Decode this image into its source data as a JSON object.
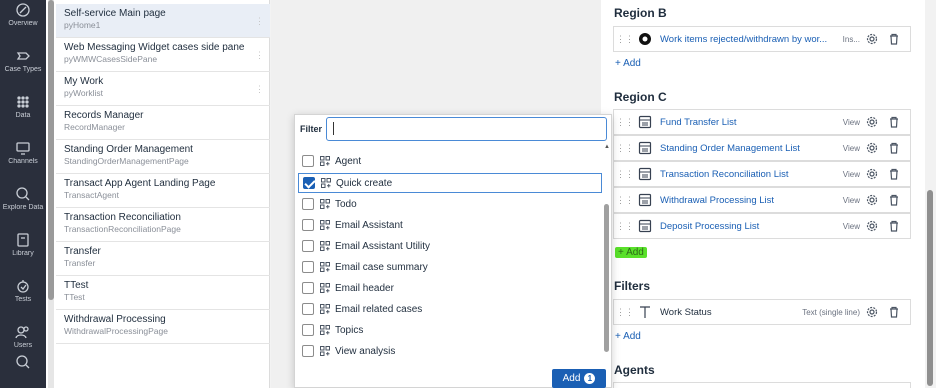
{
  "nav": [
    {
      "label": "Overview",
      "icon": "compass-icon"
    },
    {
      "label": "Case Types",
      "icon": "case-types-icon"
    },
    {
      "label": "Data",
      "icon": "grid-icon"
    },
    {
      "label": "Channels",
      "icon": "channels-icon"
    },
    {
      "label": "Explore Data",
      "icon": "explore-icon"
    },
    {
      "label": "Library",
      "icon": "library-icon"
    },
    {
      "label": "Tests",
      "icon": "tests-icon"
    },
    {
      "label": "Users",
      "icon": "users-icon"
    }
  ],
  "pages": [
    {
      "title": "Self-service Main page",
      "sub": "pyHome1"
    },
    {
      "title": "Web Messaging Widget cases side pane",
      "sub": "pyWMWCasesSidePane"
    },
    {
      "title": "My Work",
      "sub": "pyWorklist"
    },
    {
      "title": "Records Manager",
      "sub": "RecordManager"
    },
    {
      "title": "Standing Order Management",
      "sub": "StandingOrderManagementPage"
    },
    {
      "title": "Transact App Agent Landing Page",
      "sub": "TransactAgent"
    },
    {
      "title": "Transaction Reconciliation",
      "sub": "TransactionReconciliationPage"
    },
    {
      "title": "Transfer",
      "sub": "Transfer"
    },
    {
      "title": "TTest",
      "sub": "TTest"
    },
    {
      "title": "Withdrawal Processing",
      "sub": "WithdrawalProcessingPage"
    }
  ],
  "popup": {
    "filter_label": "Filter",
    "filter_value": "",
    "options": [
      {
        "label": "Agent",
        "checked": false
      },
      {
        "label": "Quick create",
        "checked": true
      },
      {
        "label": "Todo",
        "checked": false
      },
      {
        "label": "Email Assistant",
        "checked": false
      },
      {
        "label": "Email Assistant Utility",
        "checked": false
      },
      {
        "label": "Email case summary",
        "checked": false
      },
      {
        "label": "Email header",
        "checked": false
      },
      {
        "label": "Email related cases",
        "checked": false
      },
      {
        "label": "Topics",
        "checked": false
      },
      {
        "label": "View analysis",
        "checked": false
      }
    ],
    "add_label": "Add",
    "add_count": "1"
  },
  "right": {
    "region_b": {
      "title": "Region B",
      "rows": [
        {
          "label": "Work items rejected/withdrawn by wor...",
          "type": "Ins..."
        }
      ],
      "add": "+ Add"
    },
    "region_c": {
      "title": "Region C",
      "rows": [
        {
          "label": "Fund Transfer List",
          "type": "View"
        },
        {
          "label": "Standing Order Management List",
          "type": "View"
        },
        {
          "label": "Transaction Reconciliation List",
          "type": "View"
        },
        {
          "label": "Withdrawal Processing List",
          "type": "View"
        },
        {
          "label": "Deposit Processing List",
          "type": "View"
        }
      ],
      "add": "+ Add"
    },
    "filters": {
      "title": "Filters",
      "rows": [
        {
          "label": "Work Status",
          "type": "Text (single line)"
        }
      ],
      "add": "+ Add"
    },
    "agents": {
      "title": "Agents"
    }
  },
  "colors": {
    "accent": "#1a5fb4",
    "highlight": "#59e02a",
    "nav_bg": "#2a2f3c"
  }
}
